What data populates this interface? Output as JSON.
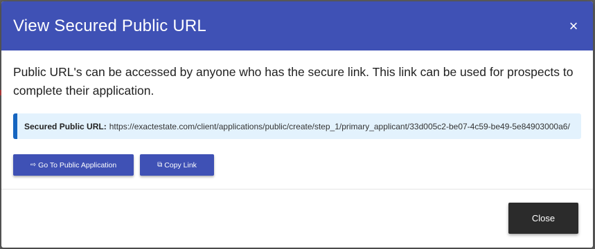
{
  "modal": {
    "title": "View Secured Public URL",
    "close_glyph": "×",
    "description": "Public URL's can be accessed by anyone who has the secure link. This link can be used for prospects to complete their application.",
    "url_label": "Secured Public URL:",
    "url_value": "https://exactestate.com/client/applications/public/create/step_1/primary_applicant/33d005c2-be07-4c59-be49-5e84903000a6/",
    "go_button_label": "Go To Public Application",
    "copy_button_label": "Copy Link",
    "close_button_label": "Close"
  },
  "icons": {
    "go": "arrow-right-icon",
    "copy": "copy-icon",
    "close": "close-icon"
  },
  "colors": {
    "header": "#3f51b5",
    "primary_button": "#3f51b5",
    "close_button": "#2b2b2b",
    "url_box_bg": "#e3f2fd",
    "url_box_accent": "#1565c0"
  }
}
